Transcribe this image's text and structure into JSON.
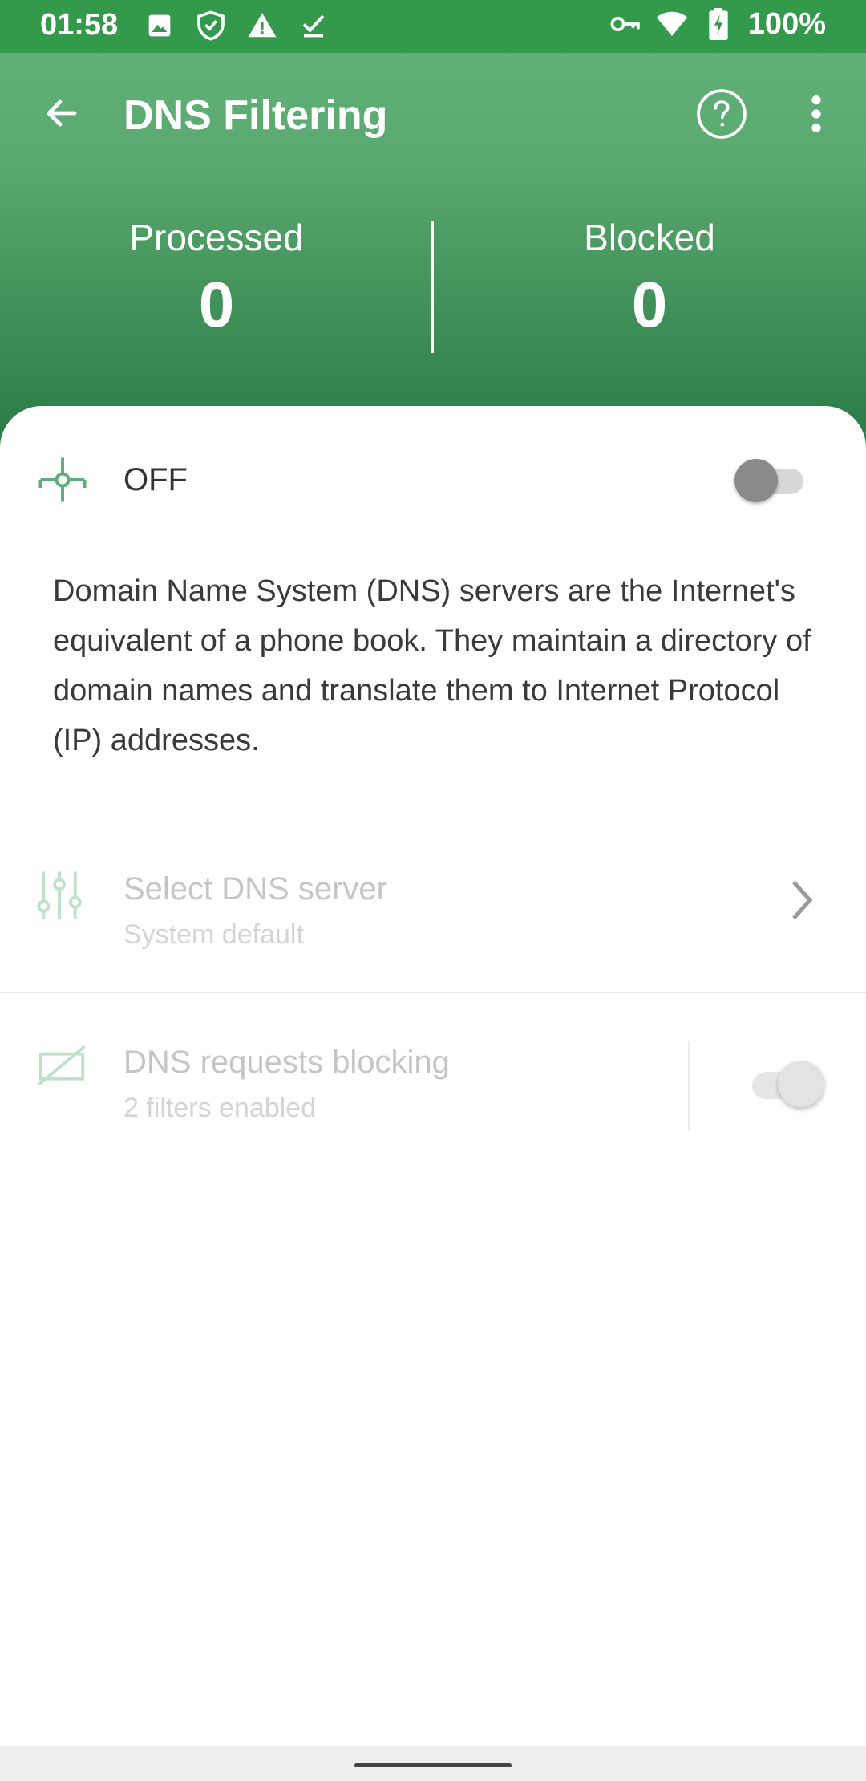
{
  "status_bar": {
    "time": "01:58",
    "battery": "100%",
    "left_icons": [
      "image-icon",
      "shield-check-icon",
      "warning-icon",
      "download-done-icon"
    ],
    "right_icons": [
      "vpn-key-icon",
      "wifi-icon",
      "battery-charging-icon"
    ]
  },
  "app_bar": {
    "title": "DNS Filtering",
    "back_icon": "arrow-back-icon",
    "help_icon": "help-circle-icon",
    "more_icon": "more-vert-icon"
  },
  "stats": {
    "processed_label": "Processed",
    "processed_value": "0",
    "blocked_label": "Blocked",
    "blocked_value": "0"
  },
  "protection": {
    "state_label": "OFF",
    "enabled": false
  },
  "description": "Domain Name System (DNS) servers are the Internet's equivalent of a phone book. They maintain a directory of domain names and translate them to Internet Protocol (IP) addresses.",
  "settings": {
    "dns_server": {
      "title": "Select DNS server",
      "subtitle": "System default"
    },
    "dns_blocking": {
      "title": "DNS requests blocking",
      "subtitle": "2 filters enabled",
      "enabled": true
    }
  },
  "colors": {
    "status_bar": "#329a4a",
    "header_top": "#64b47a",
    "header_bottom": "#2a7a46",
    "accent_green": "#4caf6c",
    "disabled_text": "#c5c5c5"
  }
}
